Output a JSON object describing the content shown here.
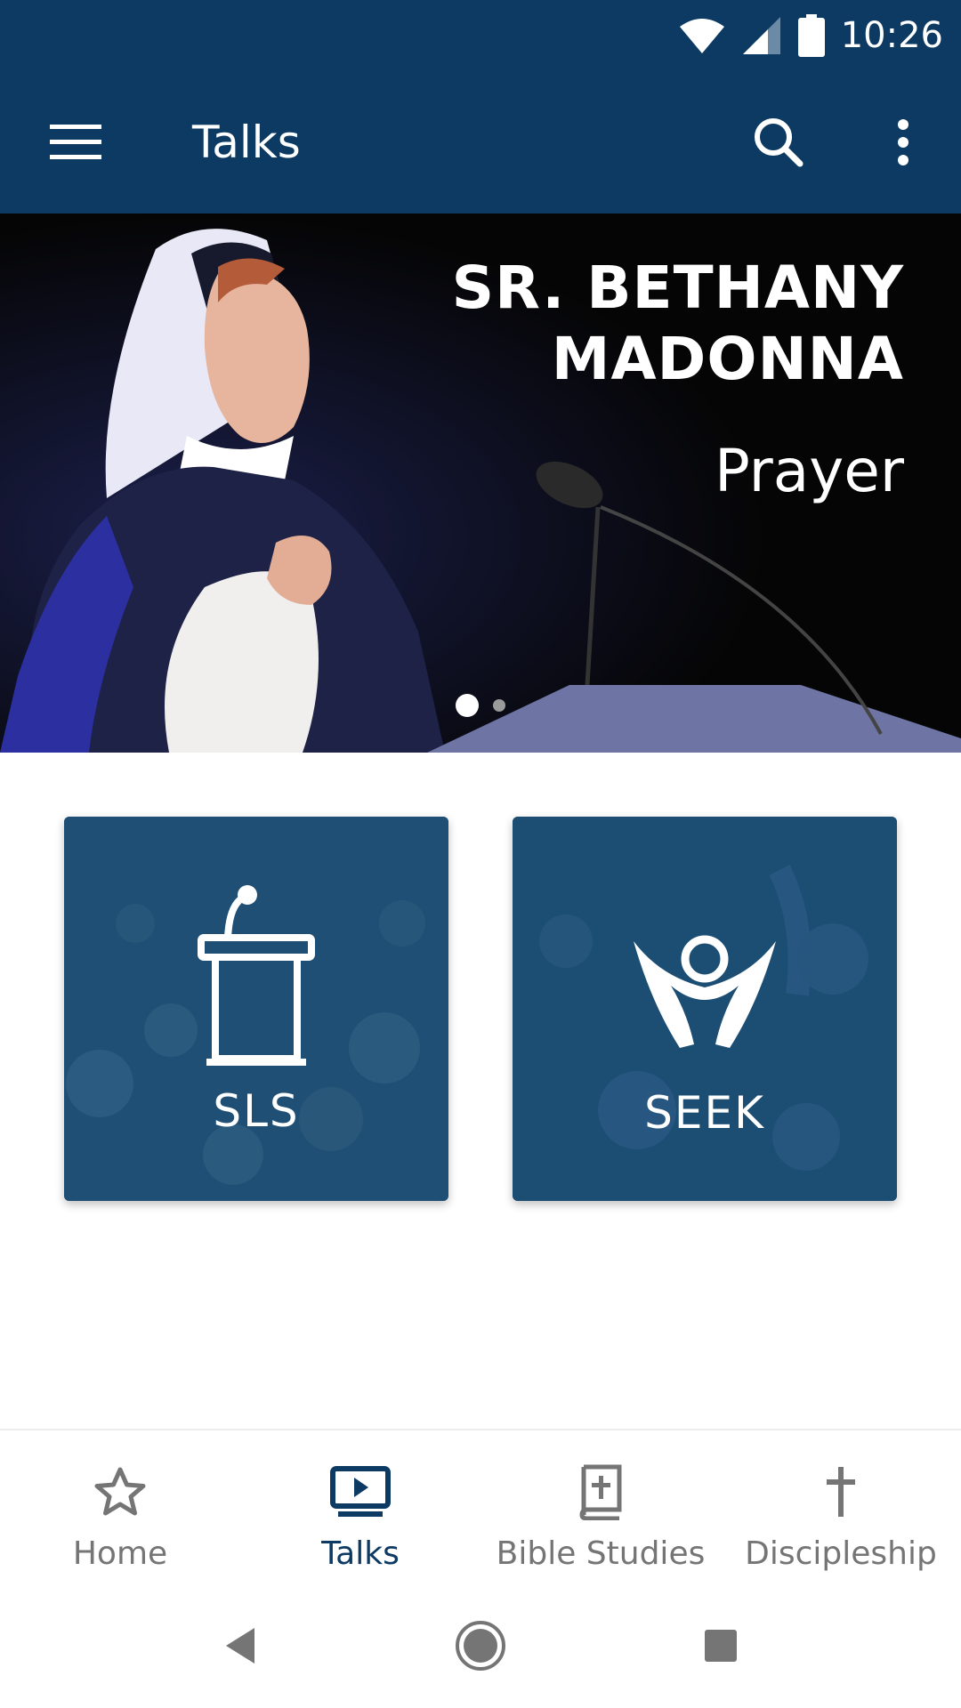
{
  "status_bar": {
    "time": "10:26",
    "icons": [
      "wifi-icon",
      "signal-icon",
      "battery-icon"
    ]
  },
  "app_bar": {
    "title": "Talks",
    "menu_icon": "hamburger-menu-icon",
    "search_icon": "search-icon",
    "more_icon": "more-vertical-icon"
  },
  "hero": {
    "speaker_line1": "SR. BETHANY",
    "speaker_line2": "MADONNA",
    "topic": "Prayer",
    "slide_count": 2,
    "active_slide": 1
  },
  "tiles": [
    {
      "label": "SLS",
      "icon": "podium-icon"
    },
    {
      "label": "SEEK",
      "icon": "praise-person-icon"
    }
  ],
  "bottom_nav": {
    "items": [
      {
        "label": "Home",
        "icon": "star-icon",
        "active": false
      },
      {
        "label": "Talks",
        "icon": "play-screen-icon",
        "active": true
      },
      {
        "label": "Bible Studies",
        "icon": "bible-icon",
        "active": false
      },
      {
        "label": "Discipleship",
        "icon": "cross-icon",
        "active": false
      }
    ]
  },
  "colors": {
    "primary": "#0c3a63",
    "tile": "#1d4e74",
    "inactive": "#757575"
  }
}
